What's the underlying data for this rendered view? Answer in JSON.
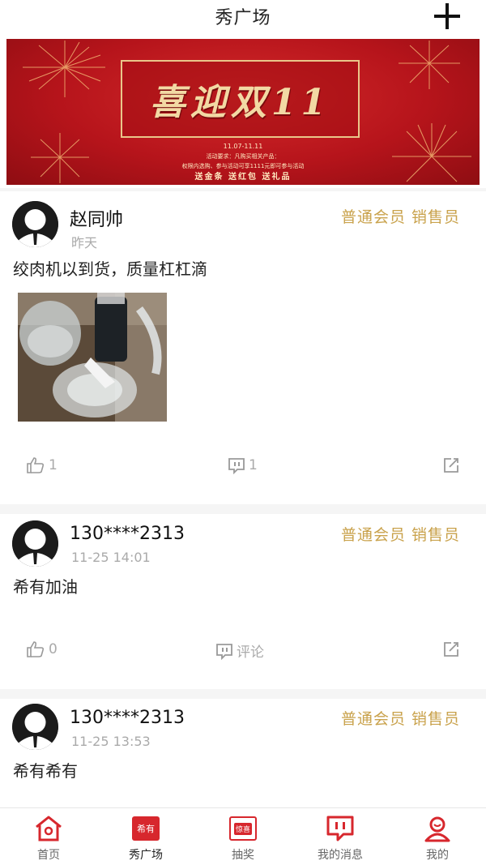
{
  "header": {
    "title": "秀广场",
    "add_icon": "plus-icon"
  },
  "banner": {
    "title": "喜迎双11",
    "date": "11.07-11.11",
    "desc_line1": "活动要求：凡购买相关产品：",
    "desc_line2": "权限内选购、参与活动可享1111元即可参与活动",
    "slogan": "送金条  送红包  送礼品",
    "colors": {
      "background": "#b6141b",
      "gold": "#f2d9a4"
    }
  },
  "posts": [
    {
      "username": "赵同帅",
      "time": "昨天",
      "member_tag": "普通会员 销售员",
      "text": "绞肉机以到货，质量杠杠滴",
      "has_photo": true,
      "likes": "1",
      "comments": "1"
    },
    {
      "username": "130****2313",
      "time": "11-25 14:01",
      "member_tag": "普通会员 销售员",
      "text": "希有加油",
      "has_photo": false,
      "likes": "0",
      "comments": "评论"
    },
    {
      "username": "130****2313",
      "time": "11-25 13:53",
      "member_tag": "普通会员 销售员",
      "text": "希有希有"
    }
  ],
  "bottom_nav": [
    {
      "label": "首页",
      "icon": "home-icon"
    },
    {
      "label": "秀广场",
      "icon": "xiuyou-badge-icon",
      "badge_text": "希有",
      "active": true
    },
    {
      "label": "抽奖",
      "icon": "lottery-icon",
      "badge_text": "惊喜"
    },
    {
      "label": "我的消息",
      "icon": "message-icon"
    },
    {
      "label": "我的",
      "icon": "profile-icon"
    }
  ],
  "colors": {
    "accent": "#d7272d",
    "member_gold": "#c9a24c",
    "muted": "#aaaaaa"
  }
}
